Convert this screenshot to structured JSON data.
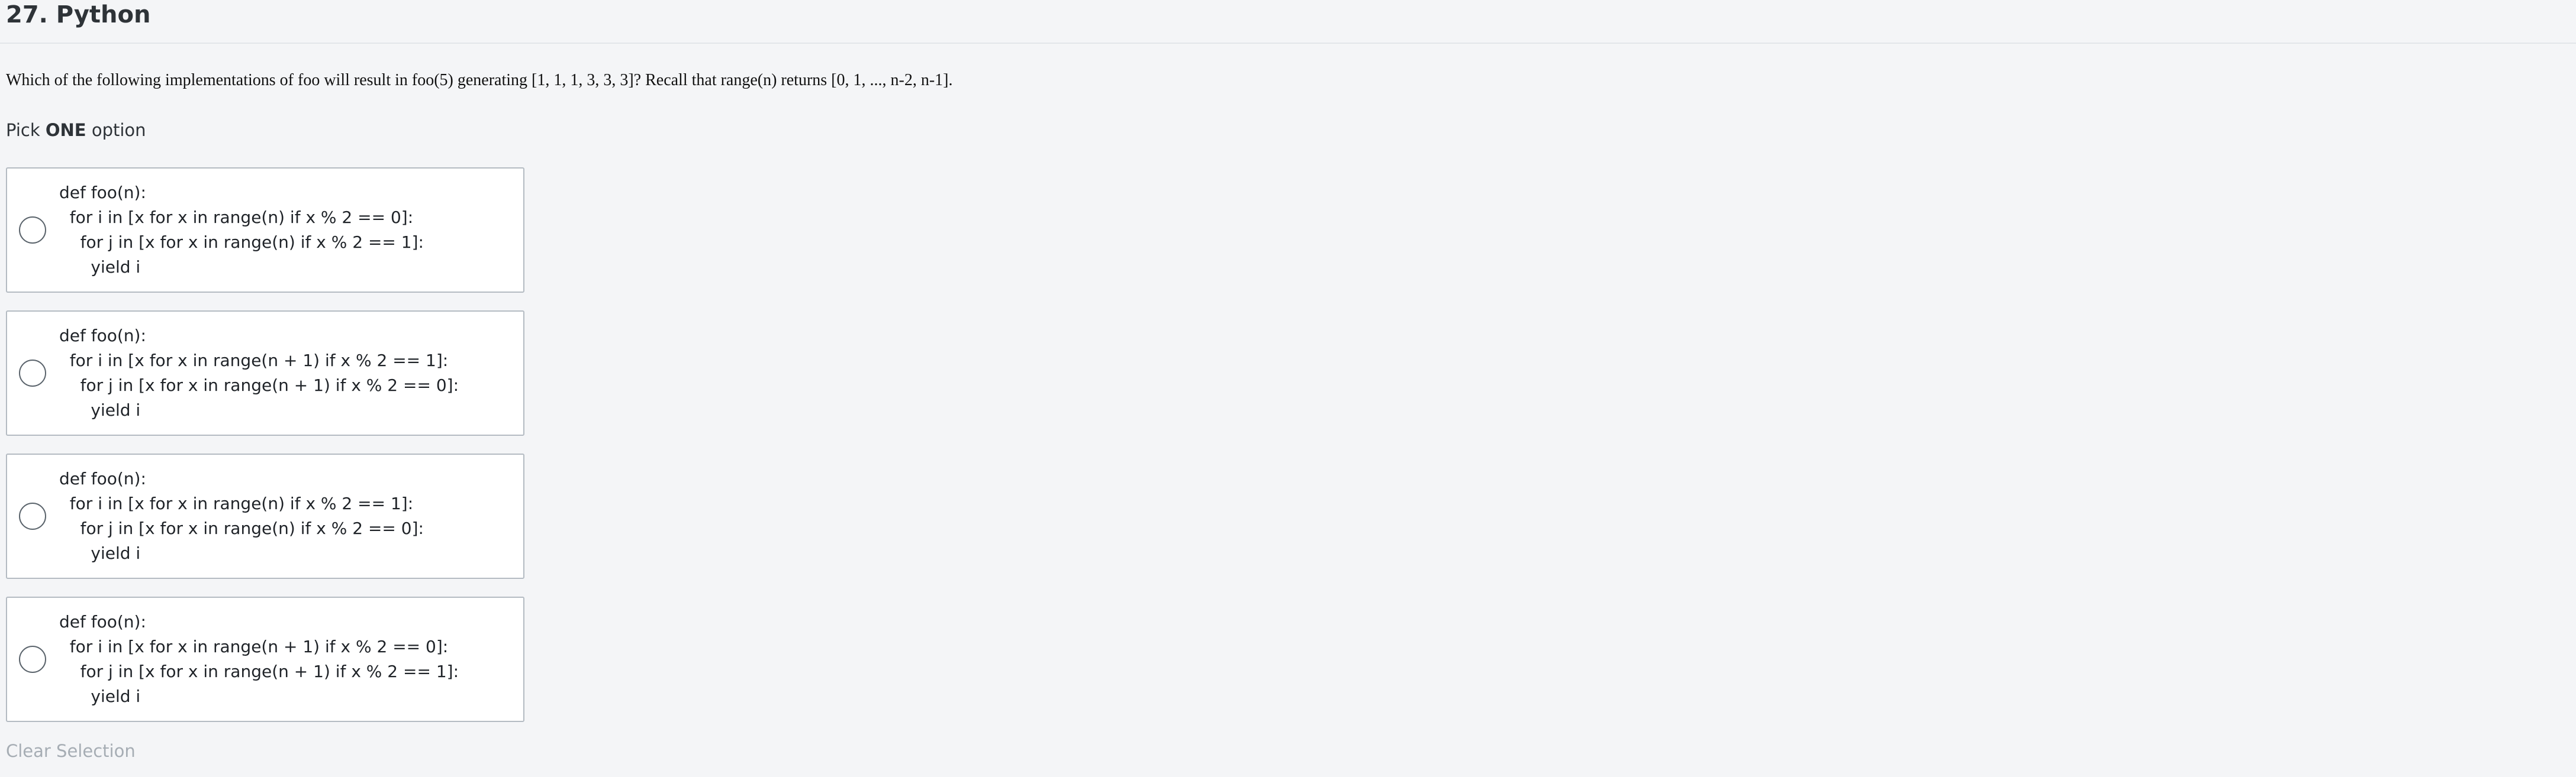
{
  "page": {
    "title": "27. Python"
  },
  "question": {
    "text": "Which of the following implementations of foo will result in foo(5) generating [1, 1, 1, 3, 3, 3]? Recall that range(n) returns [0, 1, ..., n-2, n-1].",
    "pick_prefix": "Pick ",
    "pick_emphasis": "ONE",
    "pick_suffix": " option"
  },
  "options": [
    {
      "selected": false,
      "lines": [
        "def foo(n):",
        "  for i in [x for x in range(n) if x % 2 == 0]:",
        "    for j in [x for x in range(n) if x % 2 == 1]:",
        "      yield i"
      ]
    },
    {
      "selected": false,
      "lines": [
        "def foo(n):",
        "  for i in [x for x in range(n + 1) if x % 2 == 1]:",
        "    for j in [x for x in range(n + 1) if x % 2 == 0]:",
        "      yield i"
      ]
    },
    {
      "selected": false,
      "lines": [
        "def foo(n):",
        "  for i in [x for x in range(n) if x % 2 == 1]:",
        "    for j in [x for x in range(n) if x % 2 == 0]:",
        "      yield i"
      ]
    },
    {
      "selected": false,
      "lines": [
        "def foo(n):",
        "  for i in [x for x in range(n + 1) if x % 2 == 0]:",
        "    for j in [x for x in range(n + 1) if x % 2 == 1]:",
        "      yield i"
      ]
    }
  ],
  "clear_selection_label": "Clear Selection"
}
